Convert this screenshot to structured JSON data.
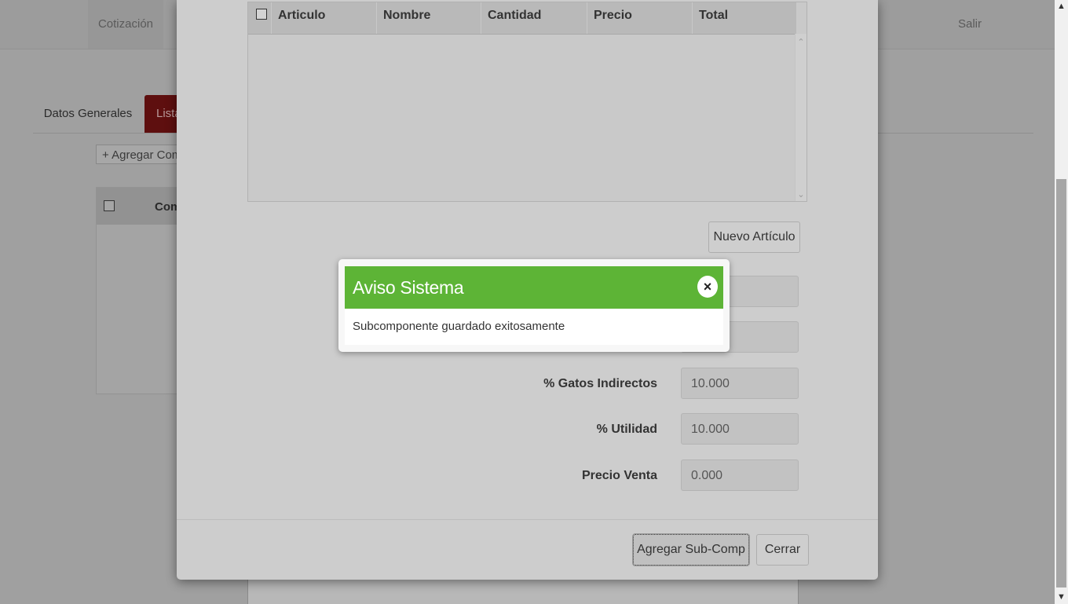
{
  "topbar": {
    "nav_cotizacion": "Cotización",
    "nav_salir": "Salir"
  },
  "tabs": {
    "datos_generales": "Datos Generales",
    "lista": "Lista"
  },
  "page": {
    "agregar_comp_label": "+ Agregar Com",
    "table_col_partial": "Com"
  },
  "modal": {
    "articles_table": {
      "columns": [
        "Articulo",
        "Nombre",
        "Cantidad",
        "Precio",
        "Total"
      ],
      "rows": []
    },
    "nuevo_articulo_label": "Nuevo Artículo",
    "fields": {
      "gastos_indirectos": {
        "label": "% Gatos Indirectos",
        "value": "10.000"
      },
      "utilidad": {
        "label": "% Utilidad",
        "value": "10.000"
      },
      "precio_venta": {
        "label": "Precio Venta",
        "value": "0.000"
      }
    },
    "agregar_sub_label": "Agregar Sub-Comp",
    "cerrar_label": "Cerrar"
  },
  "alert": {
    "title": "Aviso Sistema",
    "close_symbol": "×",
    "message": "Subcomponente guardado exitosamente"
  },
  "colors": {
    "alert_header": "#5db436",
    "active_tab": "#5e0f0f"
  },
  "icons": {
    "close": "close-icon",
    "scroll_up": "chevron-up-icon",
    "scroll_down": "chevron-down-icon"
  }
}
